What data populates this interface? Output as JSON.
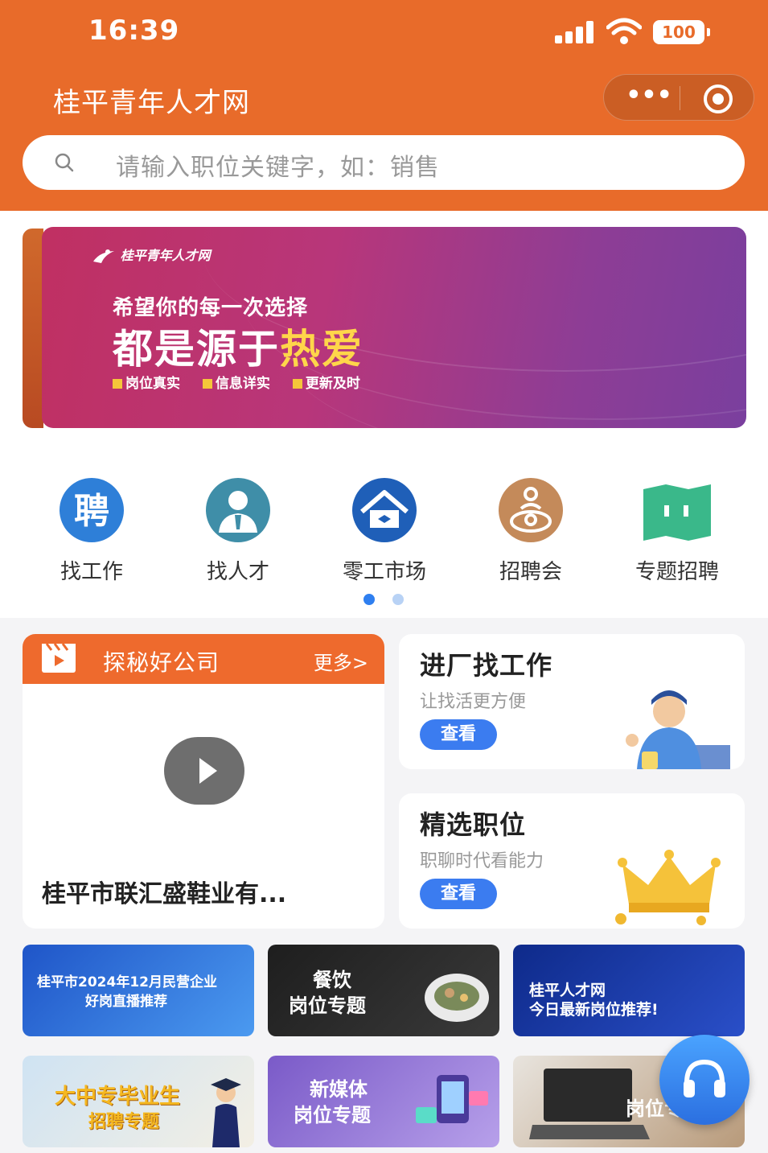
{
  "status_bar": {
    "time": "16:39",
    "battery": "100"
  },
  "header": {
    "title": "桂平青年人才网"
  },
  "search": {
    "placeholder": "请输入职位关键字，如：销售"
  },
  "banner": {
    "logo_text": "桂平青年人才网",
    "line1": "希望你的每一次选择",
    "line2_prefix": "都是源于",
    "line2_highlight": "热爱",
    "tags": [
      "岗位真实",
      "信息详实",
      "更新及时"
    ]
  },
  "quick_nav": [
    {
      "label": "找工作",
      "icon": "recruit-icon"
    },
    {
      "label": "找人才",
      "icon": "person-icon"
    },
    {
      "label": "零工市场",
      "icon": "house-icon"
    },
    {
      "label": "招聘会",
      "icon": "meeting-icon"
    },
    {
      "label": "专题招聘",
      "icon": "map-icon"
    }
  ],
  "video_card": {
    "title": "探秘好公司",
    "more": "更多>",
    "company": "桂平市联汇盛鞋业有..."
  },
  "cards": [
    {
      "title": "进厂找工作",
      "subtitle": "让找活更方便",
      "button": "查看"
    },
    {
      "title": "精选职位",
      "subtitle": "职聊时代看能力",
      "button": "查看"
    }
  ],
  "tiles": [
    {
      "line1": "桂平市2024年12月民营企业",
      "line2": "好岗直播推荐"
    },
    {
      "line1": "餐饮",
      "line2": "岗位专题"
    },
    {
      "line1": "桂平人才网",
      "line2": "今日最新岗位推荐!"
    },
    {
      "line1": "大中专毕业生",
      "line2": "招聘专题"
    },
    {
      "line1": "新媒体",
      "line2": "岗位专题"
    },
    {
      "line1": "",
      "line2": "岗位专题"
    }
  ],
  "colors": {
    "brand": "#e86b2a",
    "accent_blue": "#3b7cf0"
  }
}
